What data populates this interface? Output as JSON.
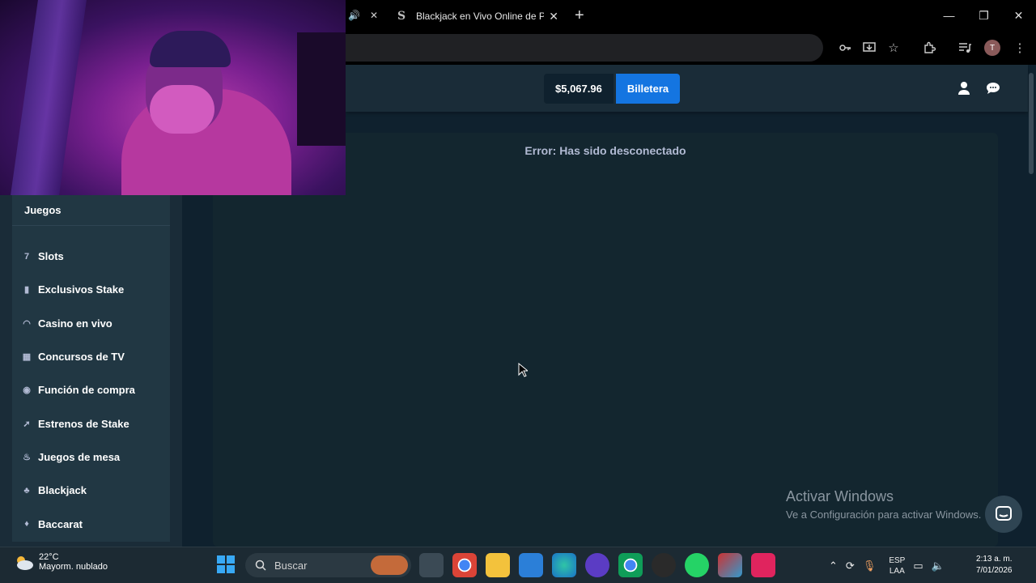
{
  "browser": {
    "active_tab_title": "Blackjack en Vivo Online de Pra",
    "prev_tab_icons": [
      "speaker-icon",
      "close-icon"
    ],
    "profile_initial": "T",
    "tab_favicon": "S"
  },
  "header": {
    "balance": "$5,067.96",
    "wallet_label": "Billetera"
  },
  "sidebar": {
    "section_title": "Juegos",
    "items": [
      {
        "label": "Slots",
        "icon": "slots-icon"
      },
      {
        "label": "Exclusivos Stake",
        "icon": "bookmark-icon"
      },
      {
        "label": "Casino en vivo",
        "icon": "headset-icon"
      },
      {
        "label": "Concursos de TV",
        "icon": "gift-icon"
      },
      {
        "label": "Función de compra",
        "icon": "buy-icon"
      },
      {
        "label": "Estrenos de Stake",
        "icon": "rocket-icon"
      },
      {
        "label": "Juegos de mesa",
        "icon": "flame-icon"
      },
      {
        "label": "Blackjack",
        "icon": "blackjack-icon"
      },
      {
        "label": "Baccarat",
        "icon": "baccarat-icon"
      }
    ]
  },
  "main": {
    "error_message": "Error: Has sido desconectado"
  },
  "watermark": {
    "title": "Activar Windows",
    "subtitle": "Ve a Configuración para activar Windows."
  },
  "taskbar": {
    "temperature": "22°C",
    "weather_desc": "Mayorm. nublado",
    "search_placeholder": "Buscar",
    "lang_line1": "ESP",
    "lang_line2": "LAA",
    "time": "2:13 a. m.",
    "date": "7/01/2026"
  },
  "colors": {
    "accent": "#1475e1",
    "bg": "#0f212e",
    "panel": "#1a2c38",
    "sidebar_nav": "#213743"
  }
}
